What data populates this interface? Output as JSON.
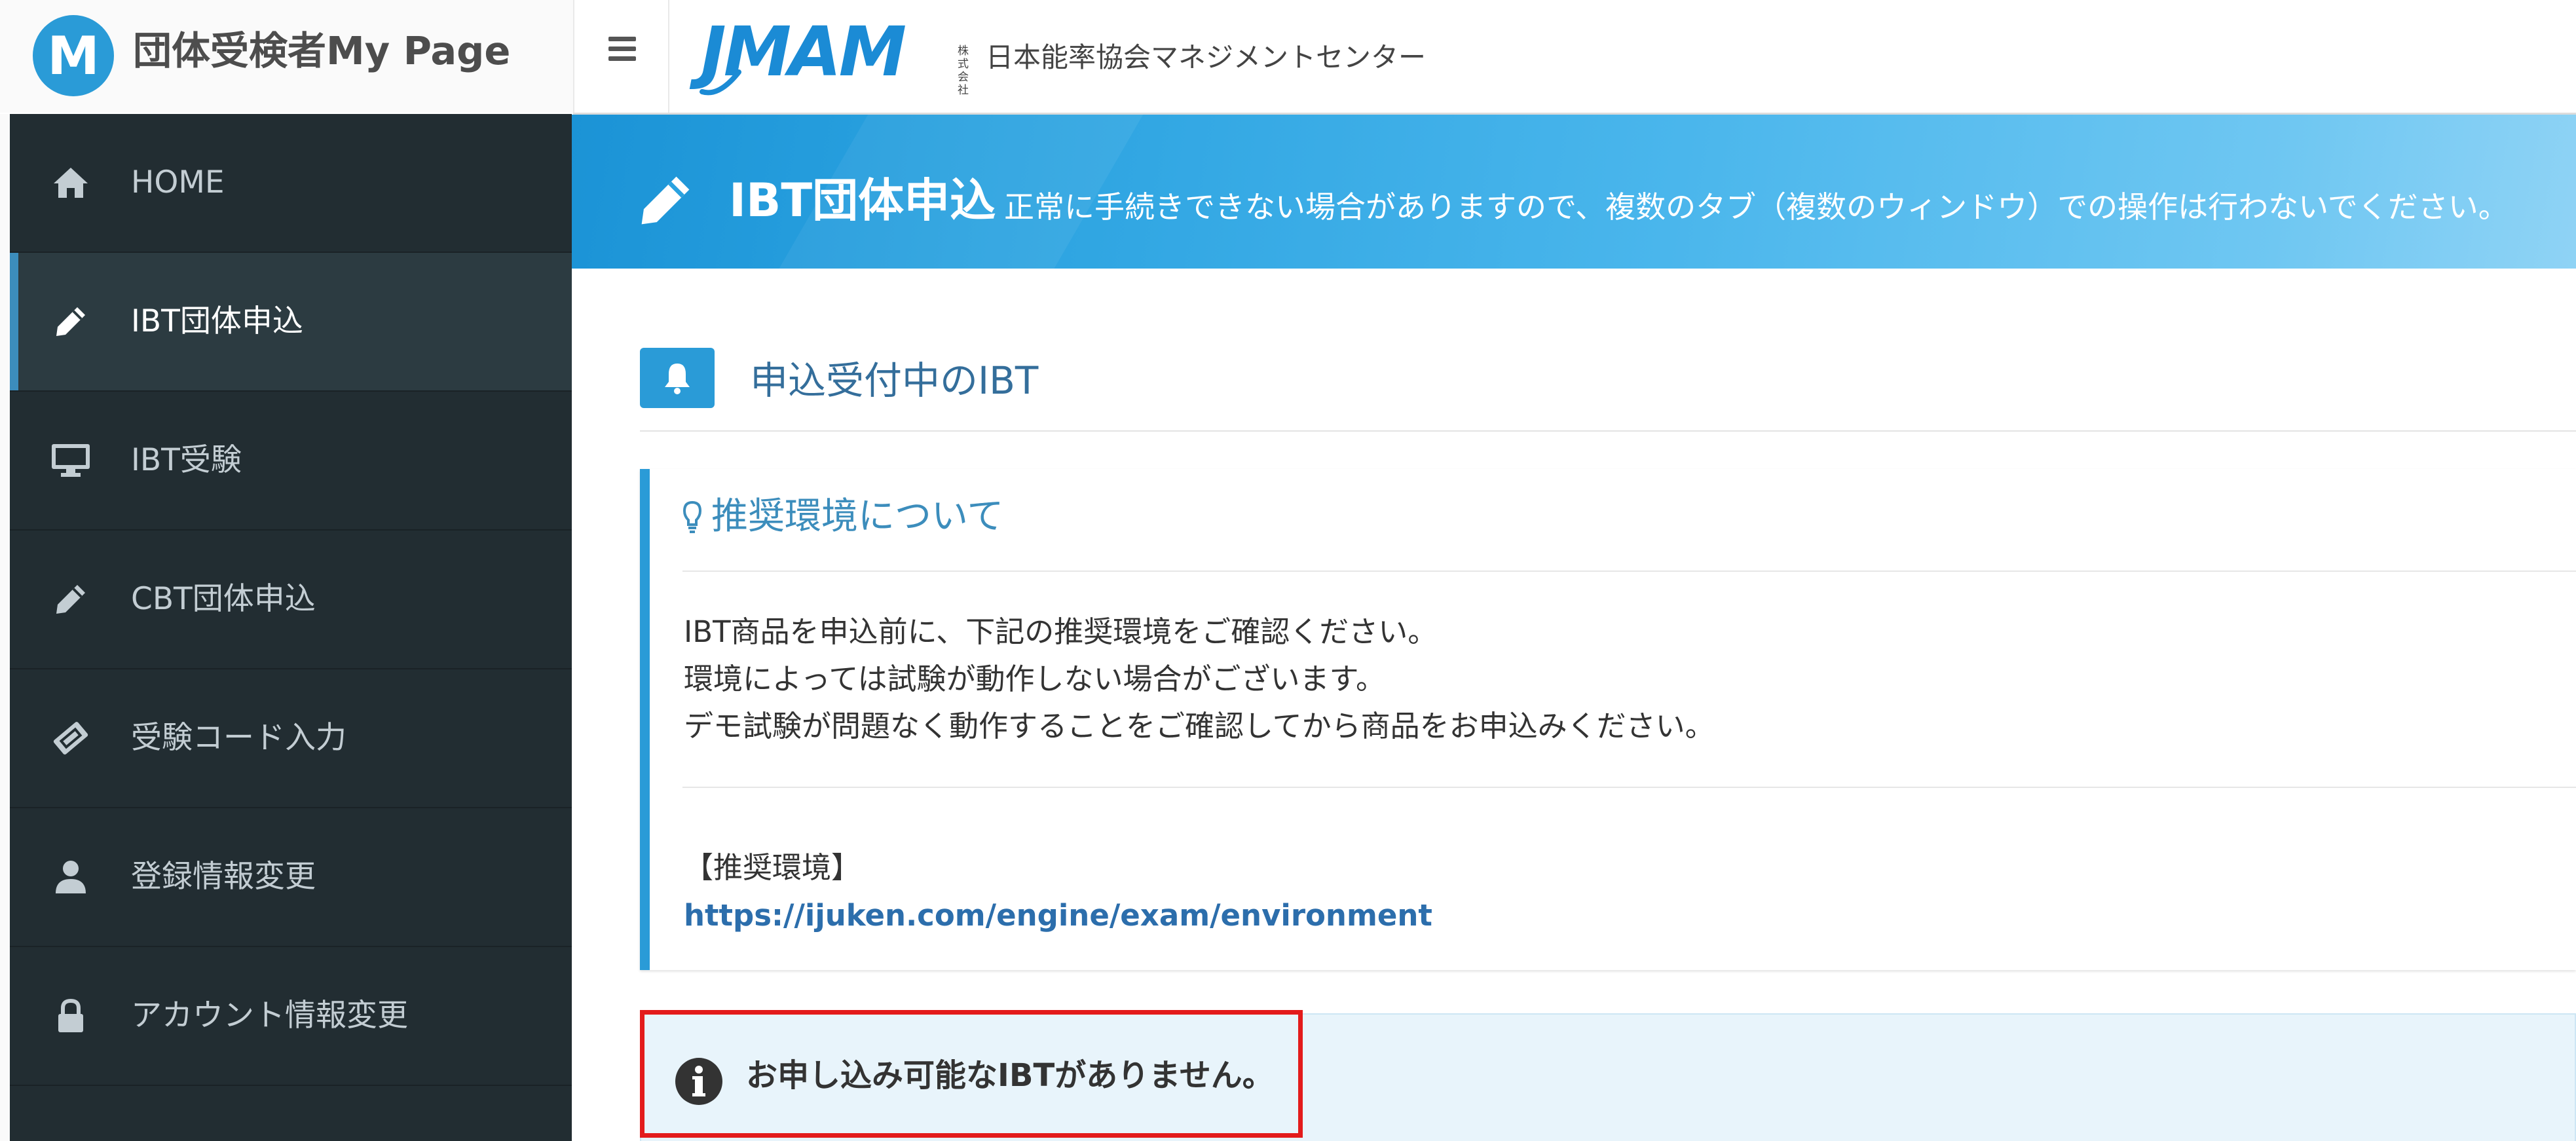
{
  "header": {
    "brand_logo_letter": "M",
    "brand_title": "団体受検者My Page",
    "logo_text": "JMAM",
    "company_prefix": "株式会社",
    "company_name": "日本能率協会マネジメントセンター"
  },
  "sidebar": {
    "items": [
      {
        "label": "HOME",
        "icon": "home-icon",
        "active": false
      },
      {
        "label": "IBT団体申込",
        "icon": "pencil-icon",
        "active": true
      },
      {
        "label": "IBT受験",
        "icon": "monitor-icon",
        "active": false
      },
      {
        "label": "CBT団体申込",
        "icon": "pencil-icon",
        "active": false
      },
      {
        "label": "受験コード入力",
        "icon": "ticket-icon",
        "active": false
      },
      {
        "label": "登録情報変更",
        "icon": "user-icon",
        "active": false
      },
      {
        "label": "アカウント情報変更",
        "icon": "lock-icon",
        "active": false
      }
    ]
  },
  "banner": {
    "title": "IBT団体申込",
    "subtitle": "正常に手続きできない場合がありますので、複数のタブ（複数のウィンドウ）での操作は行わないでください。"
  },
  "section": {
    "title": "申込受付中のIBT"
  },
  "info_box": {
    "title": "推奨環境について",
    "lines": [
      "IBT商品を申込前に、下記の推奨環境をご確認ください。",
      "環境によっては試験が動作しない場合がございます。",
      "デモ試験が問題なく動作することをご確認してから商品をお申込みください。"
    ],
    "env_heading": "【推奨環境】",
    "env_link": "https://ijuken.com/engine/exam/environment"
  },
  "alert": {
    "text": "お申し込み可能なIBTがありません。"
  },
  "colors": {
    "accent": "#2a9bd7",
    "sidebar_bg": "#222d32",
    "sidebar_active_bg": "#2c3b41",
    "highlight": "#e31b1b"
  }
}
